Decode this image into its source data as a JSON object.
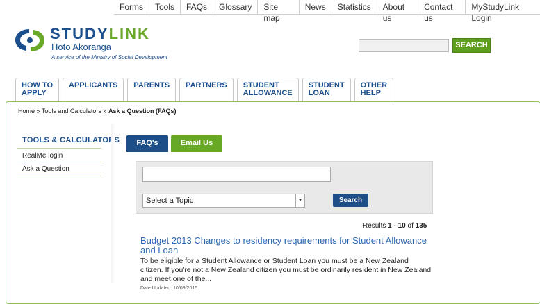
{
  "topnav": [
    "Forms",
    "Tools",
    "FAQs",
    "Glossary",
    "Site map",
    "News",
    "Statistics",
    "About us",
    "Contact us",
    "MyStudyLink Login"
  ],
  "logo": {
    "brand_part1": "STUDY",
    "brand_part2": "LINK",
    "subtitle": "Hoto Akoranga",
    "tagline": "A service of the Ministry of Social Development"
  },
  "header_search": {
    "button_label": "SEARCH",
    "placeholder": ""
  },
  "main_tabs": [
    [
      "HOW TO",
      "APPLY"
    ],
    [
      "APPLICANTS",
      ""
    ],
    [
      "PARENTS",
      ""
    ],
    [
      "PARTNERS",
      ""
    ],
    [
      "STUDENT",
      "ALLOWANCE"
    ],
    [
      "STUDENT",
      "LOAN"
    ],
    [
      "OTHER",
      "HELP"
    ]
  ],
  "breadcrumb": {
    "home": "Home",
    "sep": "»",
    "tools": "Tools and Calculators",
    "current": "Ask a Question (FAQs)"
  },
  "sidebar": {
    "title": "TOOLS & CALCULATORS",
    "items": [
      "RealMe login",
      "Ask a Question"
    ]
  },
  "faq_tabs": {
    "faq": "FAQ's",
    "email": "Email Us"
  },
  "search": {
    "query_value": "",
    "topic_selected": "Select a Topic",
    "button_label": "Search"
  },
  "results": {
    "prefix": "Results",
    "from": "1",
    "dash": "-",
    "to": "10",
    "of_word": "of",
    "total": "135",
    "items": [
      {
        "title": "Budget 2013 Changes to residency requirements for Student Allowance and Loan",
        "snippet": "To be eligible for a Student Allowance or Student Loan you must be a New Zealand citizen. If you're not a New Zealand citizen you must be  ordinarily resident in New Zealand and meet one of the...",
        "date": "Date Updated: 10/09/2015"
      }
    ]
  },
  "colors": {
    "navy": "#1d4e87",
    "green": "#67a824",
    "link": "#2a66b3"
  }
}
